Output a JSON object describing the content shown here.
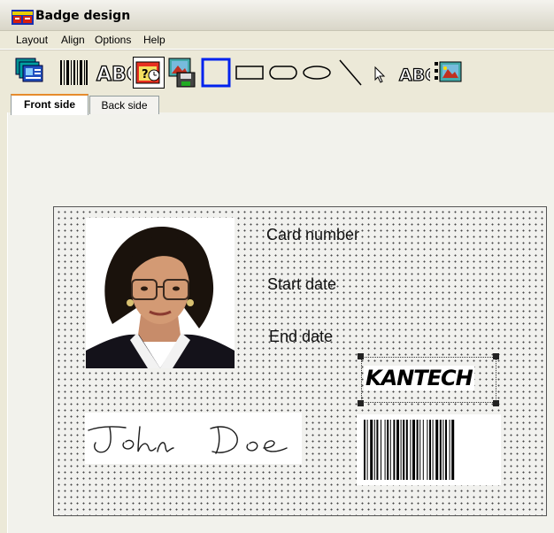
{
  "window": {
    "title": "Badge design"
  },
  "menu": [
    "Layout",
    "Align",
    "Options",
    "Help"
  ],
  "toolbar": {
    "tools": [
      {
        "name": "card-layers-icon"
      },
      {
        "name": "barcode-icon"
      },
      {
        "name": "text-abc-icon"
      },
      {
        "name": "date-field-icon"
      },
      {
        "name": "picture-save-icon"
      },
      {
        "name": "rectangle-icon"
      },
      {
        "name": "rounded-rectangle-icon"
      },
      {
        "name": "ellipse-icon"
      },
      {
        "name": "line-icon"
      },
      {
        "name": "pointer-icon"
      },
      {
        "name": "text-abc-small-icon"
      },
      {
        "name": "image-icon"
      }
    ]
  },
  "tabs": [
    {
      "label": "Front side",
      "active": true
    },
    {
      "label": "Back side",
      "active": false
    }
  ],
  "badge": {
    "card_number_label": "Card number",
    "start_date_label": "Start date",
    "end_date_label": "End date",
    "logo_text": "KANTECH",
    "signature": "John Doe"
  },
  "colors": {
    "selection_blue": "#0022ee",
    "logo_red": "#c00000"
  }
}
